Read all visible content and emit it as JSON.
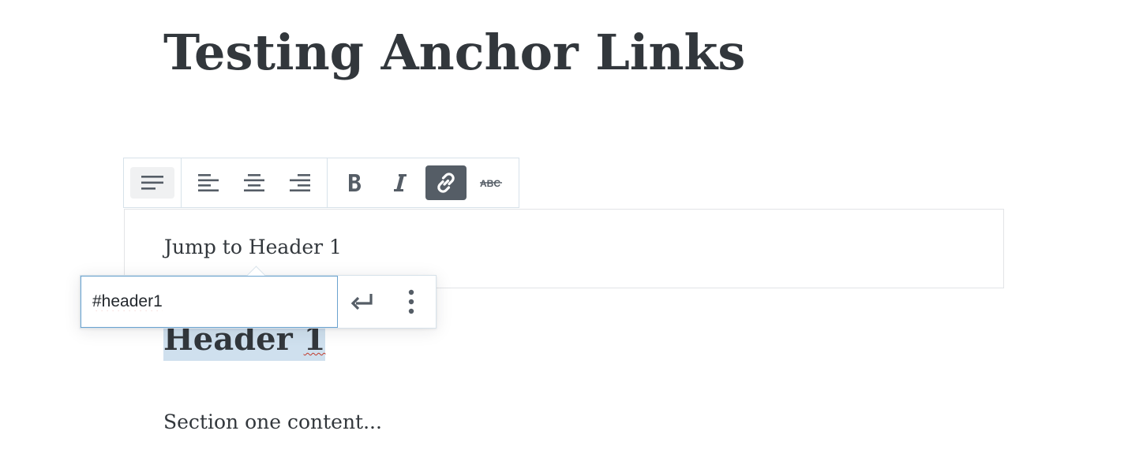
{
  "post": {
    "title": "Testing Anchor Links"
  },
  "toolbar": {
    "groups": [
      {
        "name": "block-type",
        "items": [
          {
            "icon": "paragraph-icon",
            "selected": true
          }
        ]
      },
      {
        "name": "alignment",
        "items": [
          {
            "icon": "align-left-icon"
          },
          {
            "icon": "align-center-icon"
          },
          {
            "icon": "align-right-icon"
          }
        ]
      },
      {
        "name": "formatting",
        "items": [
          {
            "icon": "bold-icon"
          },
          {
            "icon": "italic-icon"
          },
          {
            "icon": "link-icon",
            "active": true
          },
          {
            "icon": "strikethrough-icon"
          }
        ]
      }
    ]
  },
  "paragraph": {
    "text": "Jump to Header 1"
  },
  "link_popover": {
    "url_value": "#header1",
    "submit_icon": "enter-icon",
    "more_icon": "more-vertical-icon"
  },
  "heading": {
    "text_main": "Header ",
    "text_suffix": "1"
  },
  "section": {
    "text": "Section one content..."
  },
  "colors": {
    "active_button": "#555d66",
    "selection_highlight": "#cfe0ee",
    "text": "#32373c",
    "input_focus_border": "#6ba3cf"
  }
}
